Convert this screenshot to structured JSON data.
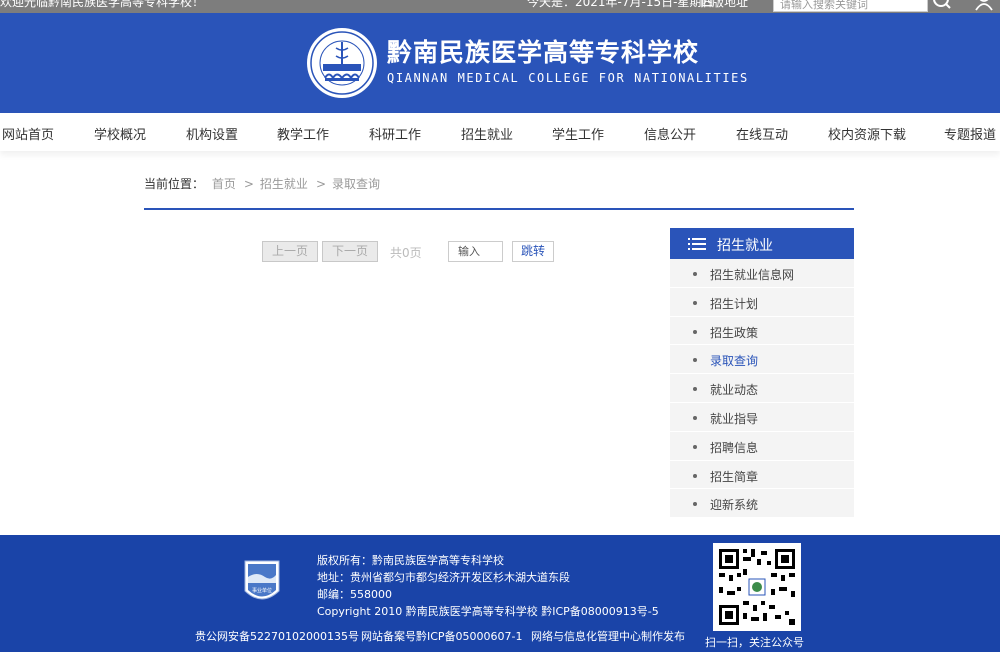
{
  "topbar": {
    "welcome": "欢迎光临黔南民族医学高等专科学校！",
    "date": "今天是：2021年-7月-15日-星期四",
    "old_site": "旧版地址",
    "search_placeholder": "请输入搜索关键词"
  },
  "header": {
    "school_name_cn": "黔南民族医学高等专科学校",
    "school_name_en": "QIANNAN MEDICAL COLLEGE FOR NATIONALITIES"
  },
  "nav": {
    "items": [
      "网站首页",
      "学校概况",
      "机构设置",
      "教学工作",
      "科研工作",
      "招生就业",
      "学生工作",
      "信息公开",
      "在线互动",
      "校内资源下载",
      "专题报道"
    ]
  },
  "breadcrumb": {
    "label": "当前位置：",
    "items": [
      "首页",
      "招生就业",
      "录取查询"
    ],
    "separator": ">"
  },
  "pager": {
    "prev": "上一页",
    "next": "下一页",
    "total": "共0页",
    "input_placeholder": "输入",
    "go": "跳转"
  },
  "sidebar": {
    "title": "招生就业",
    "items": [
      {
        "label": "招生就业信息网",
        "active": false
      },
      {
        "label": "招生计划",
        "active": false
      },
      {
        "label": "招生政策",
        "active": false
      },
      {
        "label": "录取查询",
        "active": true
      },
      {
        "label": "就业动态",
        "active": false
      },
      {
        "label": "就业指导",
        "active": false
      },
      {
        "label": "招聘信息",
        "active": false
      },
      {
        "label": "招生简章",
        "active": false
      },
      {
        "label": "迎新系统",
        "active": false
      }
    ]
  },
  "footer": {
    "copyright_cn": "版权所有：黔南民族医学高等专科学校",
    "address": "地址：贵州省都匀市都匀经济开发区杉木湖大道东段",
    "postcode": "邮编：558000",
    "copyright_en": "Copyright 2010 黔南民族医学高等专科学校 黔ICP备08000913号-5",
    "police": "贵公网安备52270102000135号",
    "icp": "网站备案号黔ICP备05000607-1",
    "maker": "网络与信息化管理中心制作发布",
    "qr_caption": "扫一扫，关注公众号",
    "badge_text": "事业单位"
  },
  "colors": {
    "brand_blue": "#2a54b9",
    "footer_blue": "#1a44a8",
    "topbar_gray": "#7d7d7d"
  },
  "icons": {
    "search": "search-icon",
    "user": "user-icon",
    "menu": "menu-icon",
    "logo": "school-logo",
    "badge": "public-institution-badge",
    "qr": "qr-code"
  }
}
